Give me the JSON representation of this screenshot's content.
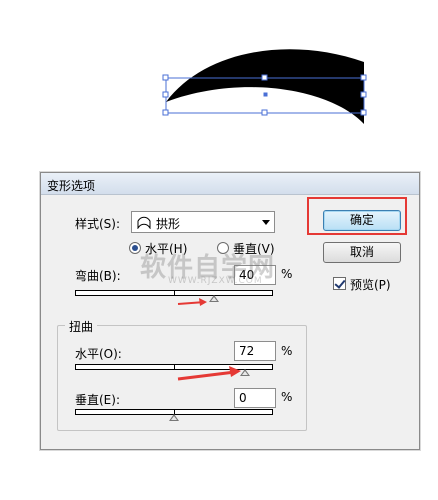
{
  "dialog": {
    "title": "变形选项",
    "style_label": "样式(S):",
    "style_value": "拱形",
    "horizontal_radio": "水平(H)",
    "vertical_radio": "垂直(V)",
    "orientation_selected": "horizontal",
    "bend_label": "弯曲(B):",
    "bend_value": "40",
    "bend_unit": "%",
    "distortion_group": "扭曲",
    "h_distort_label": "水平(O):",
    "h_distort_value": "72",
    "h_distort_unit": "%",
    "v_distort_label": "垂直(E):",
    "v_distort_value": "0",
    "v_distort_unit": "%",
    "ok_button": "确定",
    "cancel_button": "取消",
    "preview_label": "预览(P)",
    "preview_checked": true
  },
  "sliders": {
    "bend_percent": 40,
    "h_distort_percent": 72,
    "v_distort_percent": 0
  },
  "watermark": {
    "text": "软件自学网",
    "sub": "WWW.RJZXW.COM"
  },
  "colors": {
    "highlight": "#e53935",
    "annotation_arrow": "#e53935",
    "selection": "#4a6fd6",
    "shape_fill": "#000000"
  }
}
